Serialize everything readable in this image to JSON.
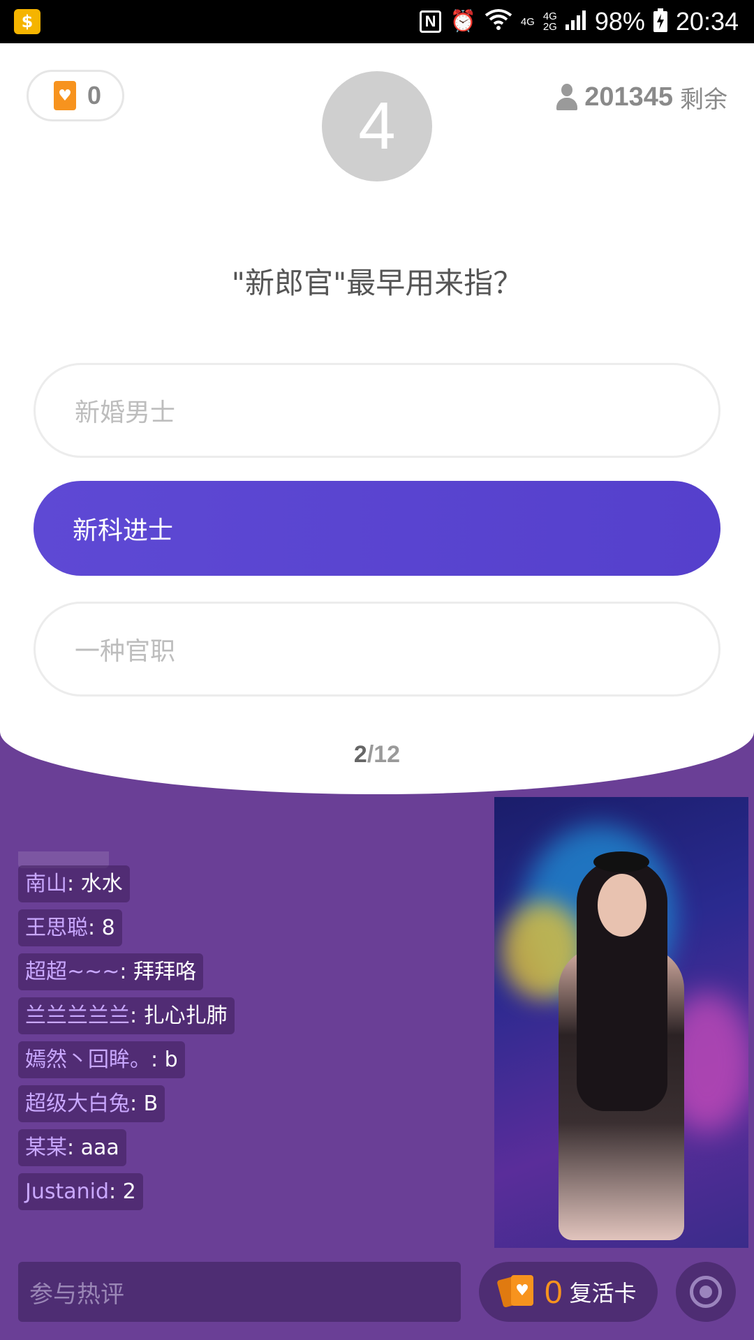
{
  "status_bar": {
    "nfc": "N",
    "network_4g": "4G",
    "network_4g2": "4G",
    "network_2g": "2G",
    "battery": "98%",
    "time": "20:34",
    "icons": [
      "app-icon",
      "nfc-icon",
      "alarm-icon",
      "wifi-icon",
      "signal-icon",
      "battery-icon"
    ]
  },
  "quiz": {
    "lives": "0",
    "countdown": "4",
    "players_count": "201345",
    "players_suffix": "剩余",
    "question": "\"新郎官\"最早用来指？",
    "options": [
      {
        "label": "新婚男士",
        "selected": false
      },
      {
        "label": "新科进士",
        "selected": true
      },
      {
        "label": "一种官职",
        "selected": false
      }
    ],
    "progress": {
      "current": "2",
      "separator": "/",
      "total": "12"
    }
  },
  "chat": [
    {
      "user": "南山",
      "message": ": 水水"
    },
    {
      "user": "王思聪",
      "message": ": 8"
    },
    {
      "user": "超超~~~",
      "message": ": 拜拜咯"
    },
    {
      "user": "兰兰兰兰兰",
      "message": ": 扎心扎肺"
    },
    {
      "user": "嫣然丶回眸。",
      "message": ": b"
    },
    {
      "user": "超级大白兔",
      "message": ": B"
    },
    {
      "user": "某某",
      "message": ": aaa"
    },
    {
      "user": "Justanid",
      "message": ": 2"
    }
  ],
  "bottom_bar": {
    "comment_placeholder": "参与热评",
    "revive_count": "0",
    "revive_label": "复活卡"
  },
  "colors": {
    "accent_purple": "#5e49d4",
    "background_purple": "#6a3f96",
    "chat_username": "#c9a8ff",
    "revive_orange": "#f7931e"
  }
}
